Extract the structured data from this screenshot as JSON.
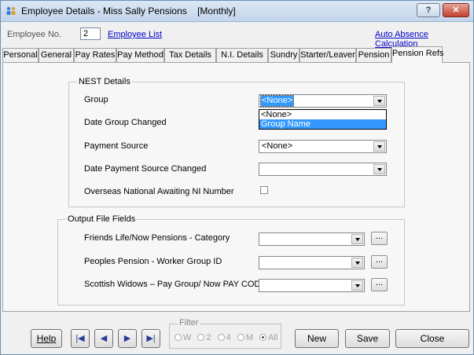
{
  "window": {
    "title": "Employee Details - Miss Sally Pensions    [Monthly]",
    "help_label": "?",
    "close_label": "✕"
  },
  "employee": {
    "label": "Employee No.",
    "number": "2",
    "list_link": "Employee List",
    "auto_absence_link": "Auto Absence Calculation"
  },
  "tabs": [
    {
      "label": "Personal"
    },
    {
      "label": "General"
    },
    {
      "label": "Pay Rates"
    },
    {
      "label": "Pay Method"
    },
    {
      "label": "Tax Details"
    },
    {
      "label": "N.I. Details"
    },
    {
      "label": "Sundry"
    },
    {
      "label": "Starter/Leaver"
    },
    {
      "label": "Pension"
    },
    {
      "label": "Pension Refs"
    }
  ],
  "active_tab": "Pension Refs",
  "nest": {
    "title": "NEST Details",
    "group_label": "Group",
    "group_value": "<None>",
    "group_options": [
      "<None>",
      "Group Name"
    ],
    "date_group_changed_label": "Date Group Changed",
    "payment_source_label": "Payment Source",
    "payment_source_value": "<None>",
    "date_payment_source_changed_label": "Date Payment Source Changed",
    "date_payment_source_changed_value": "",
    "overseas_label": "Overseas National Awaiting NI Number",
    "overseas_checked": false
  },
  "output": {
    "title": "Output File Fields",
    "friends_life_label": "Friends Life/Now Pensions - Category",
    "friends_life_value": "",
    "peoples_pension_label": "Peoples Pension - Worker Group ID",
    "peoples_pension_value": "",
    "scottish_widows_label": "Scottish Widows – Pay Group/ Now PAY CODE",
    "scottish_widows_value": "",
    "ellipsis_label": "..."
  },
  "footer": {
    "help_label": "Help",
    "nav_first": "|◀",
    "nav_prev": "◀",
    "nav_next": "▶",
    "nav_last": "▶|",
    "filter_title": "Filter",
    "filter_options": [
      "W",
      "2",
      "4",
      "M",
      "All"
    ],
    "filter_selected": "All",
    "new_label": "New",
    "save_label": "Save",
    "close_label": "Close"
  }
}
